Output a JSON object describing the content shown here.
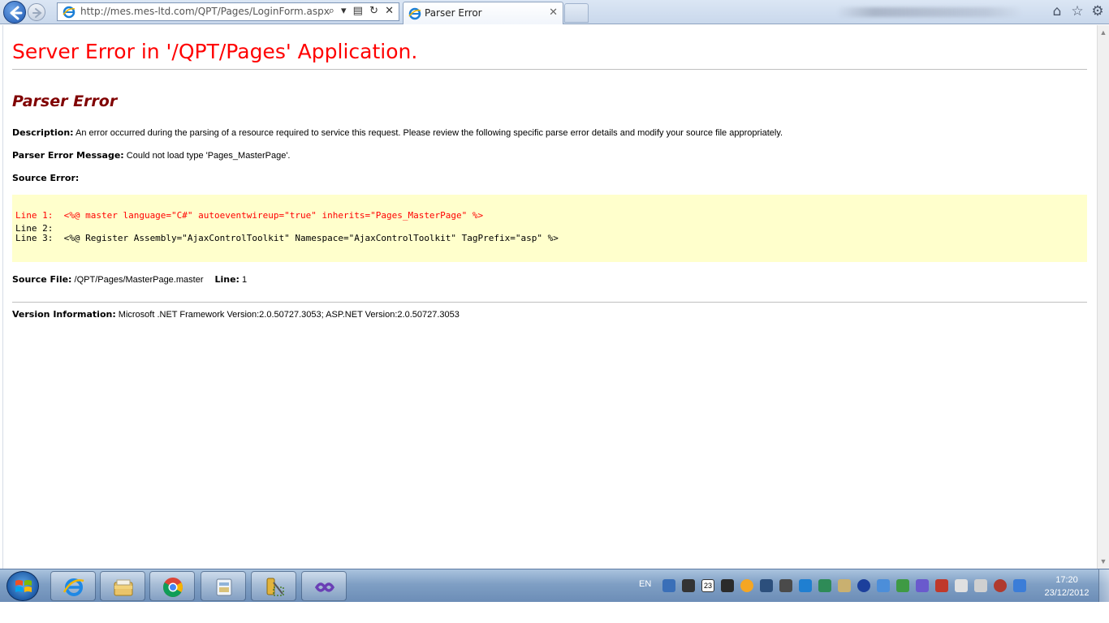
{
  "browser": {
    "address_url": "http://mes.mes-ltd.com/QPT/Pages/LoginForm.aspx",
    "address_tools": "⌕ ▾ ▤ ↻ ✕",
    "tab_title": "Parser Error",
    "tab_close": "✕",
    "home_icon": "⌂",
    "favorites_icon": "☆",
    "tools_icon": "⚙"
  },
  "page": {
    "server_error_title": "Server Error in '/QPT/Pages' Application.",
    "parser_error_heading": "Parser Error",
    "description_label": "Description:",
    "description_text": " An error occurred during the parsing of a resource required to service this request. Please review the following specific parse error details and modify your source file appropriately.",
    "message_label": "Parser Error Message:",
    "message_text": " Could not load type 'Pages_MasterPage'.",
    "source_error_label": "Source Error:",
    "code_lines": [
      "Line 1:  <%@ master language=\"C#\" autoeventwireup=\"true\" inherits=\"Pages_MasterPage\" %>",
      "Line 2:",
      "Line 3:  <%@ Register Assembly=\"AjaxControlToolkit\" Namespace=\"AjaxControlToolkit\" TagPrefix=\"asp\" %>"
    ],
    "source_file_label": "Source File:",
    "source_file_text": " /QPT/Pages/MasterPage.master",
    "line_label": "Line:",
    "line_text": " 1",
    "version_label": "Version Information:",
    "version_text": " Microsoft .NET Framework Version:2.0.50727.3053; ASP.NET Version:2.0.50727.3053"
  },
  "taskbar": {
    "language": "EN",
    "time": "17:20",
    "date": "23/12/2012",
    "calendar_badge": "23",
    "pinned": [
      "internet-explorer-icon",
      "windows-explorer-icon",
      "chrome-icon",
      "application-icon",
      "setup-tool-icon",
      "visual-studio-icon"
    ]
  },
  "colors": {
    "error_red": "#ff0000",
    "heading_maroon": "#800000",
    "code_background": "#ffffcc"
  }
}
